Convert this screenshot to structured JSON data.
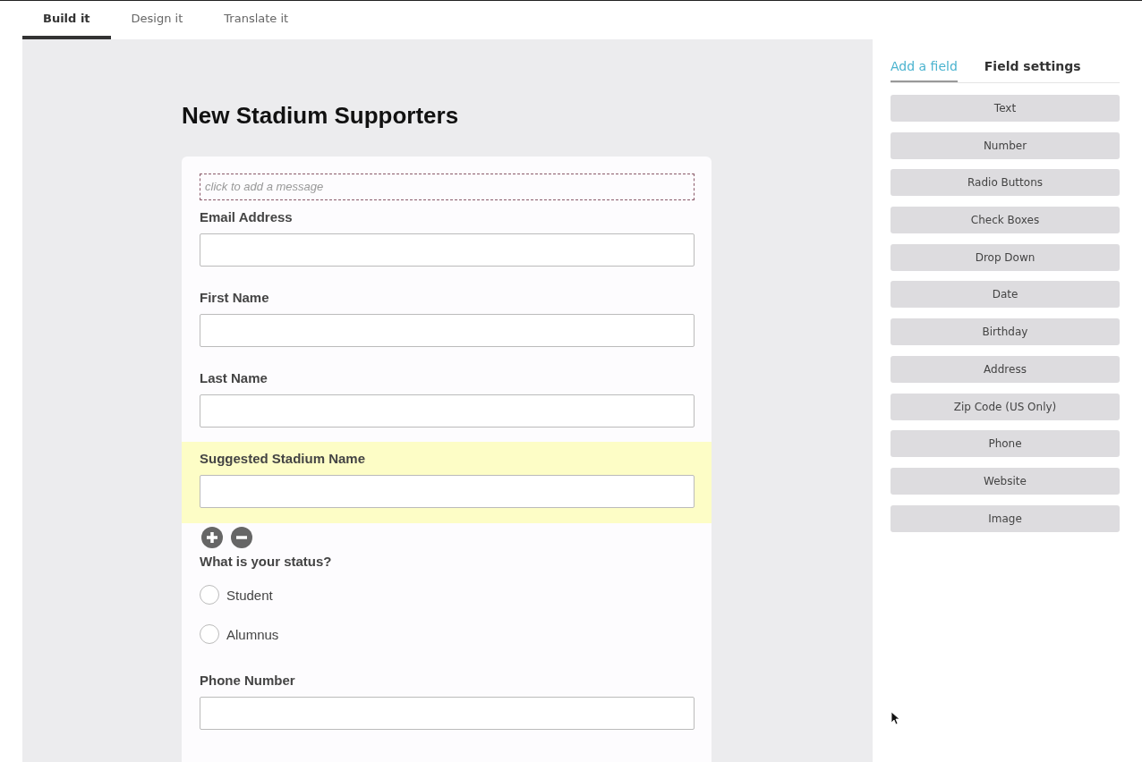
{
  "tabs": [
    {
      "label": "Build it",
      "selected": true
    },
    {
      "label": "Design it",
      "selected": false
    },
    {
      "label": "Translate it",
      "selected": false
    }
  ],
  "form": {
    "title": "New Stadium Supporters",
    "message_placeholder": "click to add a message",
    "fields": [
      {
        "kind": "text",
        "label": "Email Address",
        "selected": false
      },
      {
        "kind": "text",
        "label": "First Name",
        "selected": false
      },
      {
        "kind": "text",
        "label": "Last Name",
        "selected": false
      },
      {
        "kind": "text",
        "label": "Suggested Stadium Name",
        "selected": true
      },
      {
        "kind": "radio",
        "label": "What is your status?",
        "selected": false,
        "options": [
          {
            "label": "Student",
            "checked": false
          },
          {
            "label": "Alumnus",
            "checked": false
          }
        ]
      },
      {
        "kind": "text",
        "label": "Phone Number",
        "selected": false
      }
    ]
  },
  "panel": {
    "tabs": [
      {
        "label": "Add a field",
        "selected": true
      },
      {
        "label": "Field settings",
        "selected": false
      }
    ],
    "field_types": [
      "Text",
      "Number",
      "Radio Buttons",
      "Check Boxes",
      "Drop Down",
      "Date",
      "Birthday",
      "Address",
      "Zip Code (US Only)",
      "Phone",
      "Website",
      "Image"
    ]
  }
}
